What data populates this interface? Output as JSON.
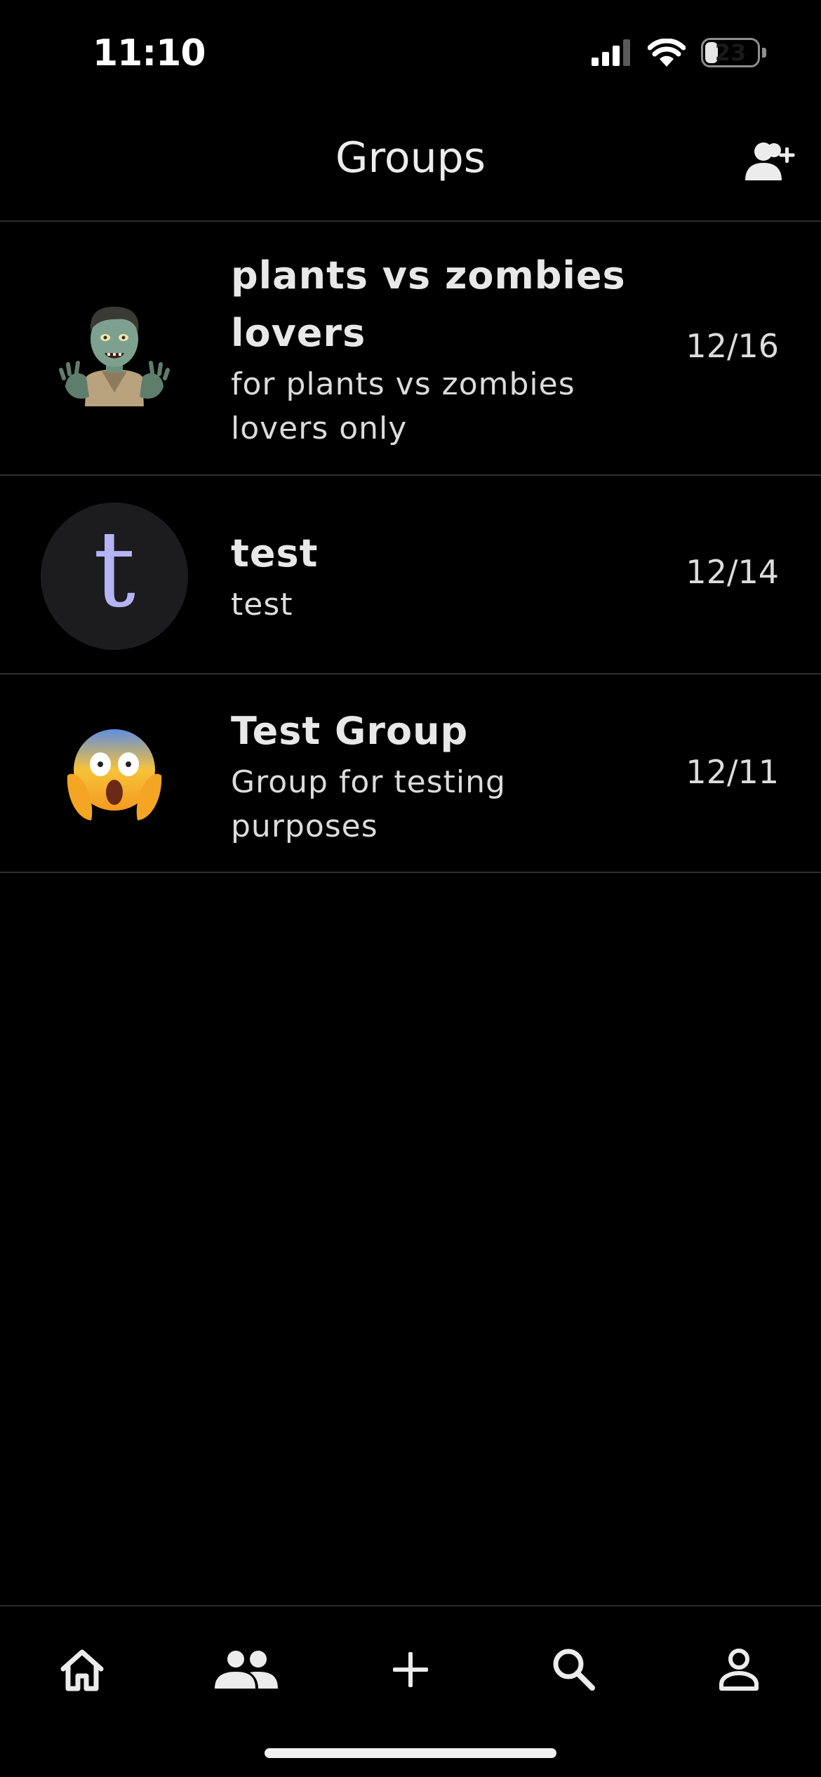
{
  "status_bar": {
    "time": "11:10",
    "battery": "23",
    "icons": [
      "signal-icon",
      "wifi-icon",
      "battery-icon"
    ]
  },
  "header": {
    "title": "Groups",
    "action_icon": "add-member-icon"
  },
  "groups": [
    {
      "name": "plants vs zombies lovers",
      "description": "for plants vs zombies lovers only",
      "date": "12/16",
      "avatar": "zombie-emoji"
    },
    {
      "name": "test",
      "description": "test",
      "date": "12/14",
      "avatar_letter": "t"
    },
    {
      "name": "Test Group",
      "description": "Group for testing purposes",
      "date": "12/11",
      "avatar": "screaming-face-emoji"
    }
  ],
  "nav": {
    "items": [
      "home-icon",
      "groups-icon",
      "add-icon",
      "search-icon",
      "profile-icon"
    ],
    "active": "groups-icon"
  },
  "colors": {
    "background": "#000000",
    "divider": "#2e2e2e",
    "text": "#e6e6e6",
    "avatar_letter": "#b7b4f5",
    "avatar_bg": "#1c1c1e"
  }
}
